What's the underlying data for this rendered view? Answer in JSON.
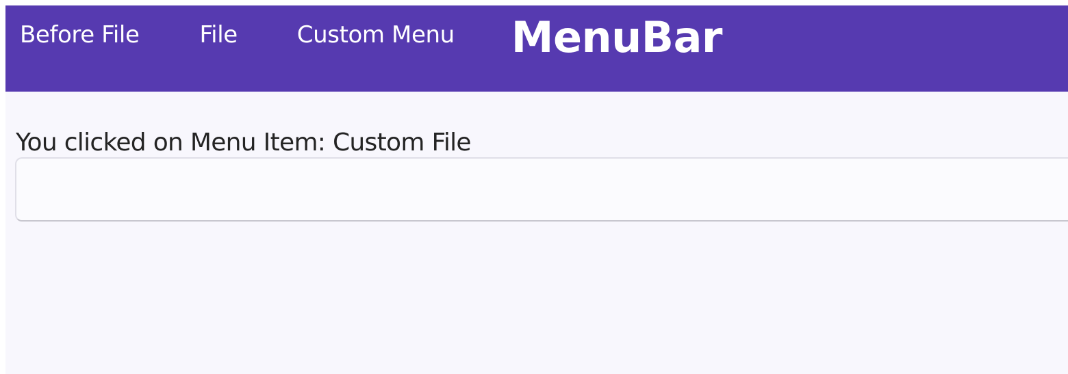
{
  "menubar": {
    "items": [
      {
        "label": "Before File"
      },
      {
        "label": "File"
      },
      {
        "label": "Custom Menu"
      }
    ],
    "title": "MenuBar"
  },
  "content": {
    "status_text": "You clicked on Menu Item: Custom File",
    "input": {
      "value": "",
      "placeholder": ""
    }
  },
  "colors": {
    "menubar_background": "#563ab0",
    "menu_text": "#ffffff",
    "page_background": "#f8f7fd",
    "body_text": "#242424"
  }
}
